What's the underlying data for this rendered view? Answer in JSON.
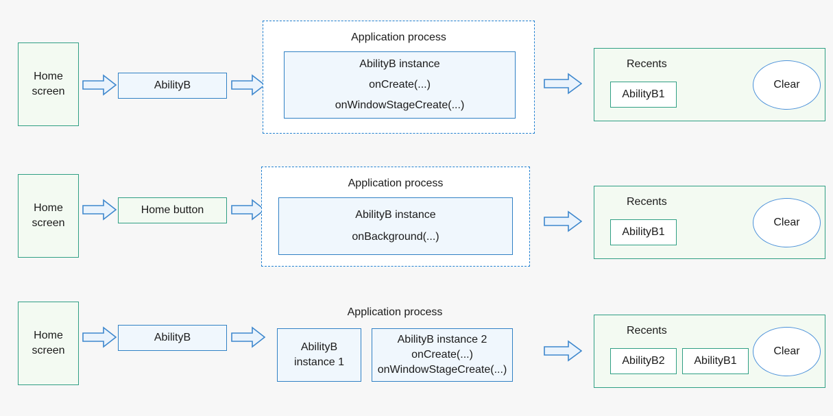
{
  "diagram": {
    "title": "AbilityB launch, home button and multiton instance flows",
    "background_color": "#f7f7f7",
    "colors": {
      "green_border": "#2e9e83",
      "green_fill": "#f3faf2",
      "blue_border": "#2f80c4",
      "blue_fill": "#f0f7fd",
      "dashed_border": "#1f7fd0",
      "ellipse_border": "#4a90d9",
      "text": "#1a1a1a"
    }
  },
  "rows": [
    {
      "id": "row-1",
      "home_screen": {
        "line1": "Home",
        "line2": "screen"
      },
      "action": {
        "label": "AbilityB",
        "style": "blue"
      },
      "process": {
        "title": "Application process",
        "bordered": true,
        "instances": [
          {
            "lines": [
              "AbilityB instance",
              "onCreate(...)",
              "onWindowStageCreate(...)"
            ]
          }
        ]
      },
      "recents": {
        "title": "Recents",
        "chips": [
          "AbilityB1"
        ],
        "clear_label": "Clear"
      }
    },
    {
      "id": "row-2",
      "home_screen": {
        "line1": "Home",
        "line2": "screen"
      },
      "action": {
        "label": "Home button",
        "style": "green"
      },
      "process": {
        "title": "Application process",
        "bordered": true,
        "instances": [
          {
            "lines": [
              "AbilityB instance",
              "onBackground(...)"
            ]
          }
        ]
      },
      "recents": {
        "title": "Recents",
        "chips": [
          "AbilityB1"
        ],
        "clear_label": "Clear"
      }
    },
    {
      "id": "row-3",
      "home_screen": {
        "line1": "Home",
        "line2": "screen"
      },
      "action": {
        "label": "AbilityB",
        "style": "blue"
      },
      "process": {
        "title": "Application process",
        "bordered": false,
        "instances": [
          {
            "lines": [
              "AbilityB",
              "instance 1"
            ]
          },
          {
            "lines": [
              "AbilityB instance 2",
              "onCreate(...)",
              "onWindowStageCreate(...)"
            ]
          }
        ]
      },
      "recents": {
        "title": "Recents",
        "chips": [
          "AbilityB2",
          "AbilityB1"
        ],
        "clear_label": "Clear"
      }
    }
  ],
  "arrows": {
    "icon": "block-arrow-right-icon",
    "count_per_row": 3
  }
}
